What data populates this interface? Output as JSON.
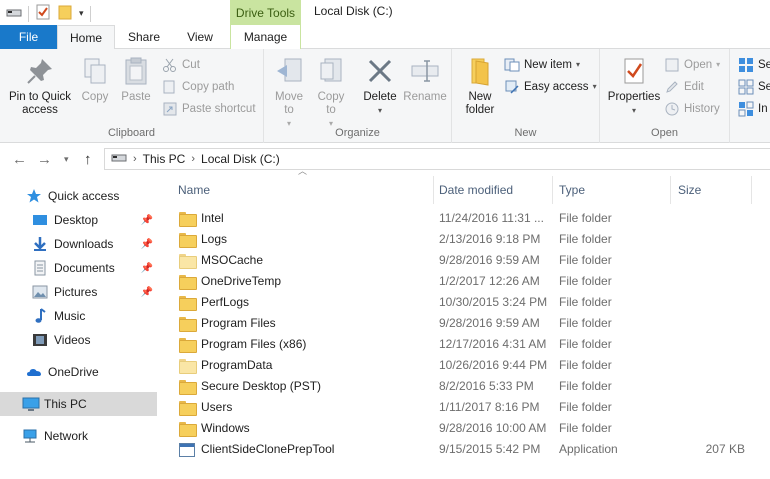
{
  "window": {
    "title": "Local Disk (C:)",
    "context_tab": "Drive Tools"
  },
  "tabs": {
    "file": "File",
    "home": "Home",
    "share": "Share",
    "view": "View",
    "manage": "Manage"
  },
  "ribbon": {
    "clipboard": {
      "label": "Clipboard",
      "pin": "Pin to Quick access",
      "copy": "Copy",
      "paste": "Paste",
      "cut": "Cut",
      "copy_path": "Copy path",
      "paste_shortcut": "Paste shortcut"
    },
    "organize": {
      "label": "Organize",
      "move_to": "Move to",
      "copy_to": "Copy to",
      "delete": "Delete",
      "rename": "Rename"
    },
    "new": {
      "label": "New",
      "new_folder": "New folder",
      "new_item": "New item",
      "easy_access": "Easy access"
    },
    "open": {
      "label": "Open",
      "properties": "Properties",
      "open": "Open",
      "edit": "Edit",
      "history": "History"
    },
    "select": {
      "select_all": "Se",
      "select_none": "Se",
      "invert": "In"
    }
  },
  "address": {
    "crumbs": [
      "This PC",
      "Local Disk (C:)"
    ]
  },
  "nav": {
    "quick_access": "Quick access",
    "desktop": "Desktop",
    "downloads": "Downloads",
    "documents": "Documents",
    "pictures": "Pictures",
    "music": "Music",
    "videos": "Videos",
    "onedrive": "OneDrive",
    "this_pc": "This PC",
    "network": "Network"
  },
  "columns": {
    "name": "Name",
    "date": "Date modified",
    "type": "Type",
    "size": "Size"
  },
  "files": [
    {
      "name": "Intel",
      "date": "11/24/2016 11:31 ...",
      "type": "File folder",
      "size": ""
    },
    {
      "name": "Logs",
      "date": "2/13/2016 9:18 PM",
      "type": "File folder",
      "size": ""
    },
    {
      "name": "MSOCache",
      "date": "9/28/2016 9:59 AM",
      "type": "File folder",
      "size": ""
    },
    {
      "name": "OneDriveTemp",
      "date": "1/2/2017 12:26 AM",
      "type": "File folder",
      "size": ""
    },
    {
      "name": "PerfLogs",
      "date": "10/30/2015 3:24 PM",
      "type": "File folder",
      "size": ""
    },
    {
      "name": "Program Files",
      "date": "9/28/2016 9:59 AM",
      "type": "File folder",
      "size": ""
    },
    {
      "name": "Program Files (x86)",
      "date": "12/17/2016 4:31 AM",
      "type": "File folder",
      "size": ""
    },
    {
      "name": "ProgramData",
      "date": "10/26/2016 9:44 PM",
      "type": "File folder",
      "size": ""
    },
    {
      "name": "Secure Desktop (PST)",
      "date": "8/2/2016 5:33 PM",
      "type": "File folder",
      "size": ""
    },
    {
      "name": "Users",
      "date": "1/11/2017 8:16 PM",
      "type": "File folder",
      "size": ""
    },
    {
      "name": "Windows",
      "date": "9/28/2016 10:00 AM",
      "type": "File folder",
      "size": ""
    },
    {
      "name": "ClientSideClonePrepTool",
      "date": "9/15/2015 5:42 PM",
      "type": "Application",
      "size": "207 KB"
    }
  ]
}
